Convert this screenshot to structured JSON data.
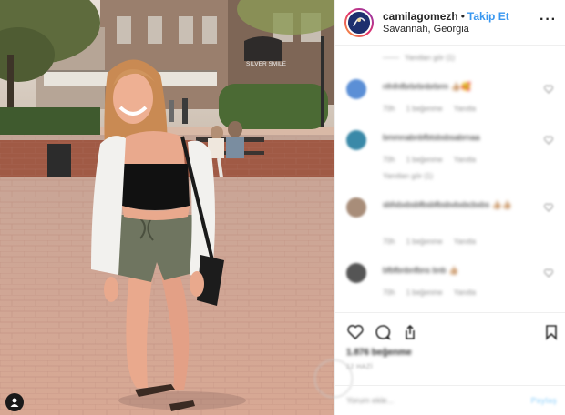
{
  "post": {
    "username": "camilagomezh",
    "separator": "•",
    "follow_label": "Takip Et",
    "location": "Savannah, Georgia",
    "more_icon": "more-horizontal-icon",
    "storefront_sign": "SILVER SMILE"
  },
  "comments": {
    "replies_link": "Yanıtları gör (1)",
    "items": [
      {
        "text": "nfnfnfbrbrbnbrbrm 👍🏼🥰",
        "time": "70h",
        "likes": "1 beğenme",
        "reply": "Yanıtla",
        "sub": "",
        "avatar_color": "#5b8fd6"
      },
      {
        "text": "bmmnabnbfbtsbsbsabrnaa",
        "time": "70h",
        "likes": "1 beğenme",
        "reply": "Yanıtla",
        "sub": "Yanıtları gör (1)",
        "avatar_color": "#3a89a8"
      },
      {
        "text": "sbfxbxbsbfbsbfbsbvbxbcbxbs 👍🏼👍🏼",
        "time": "70h",
        "likes": "1 beğenme",
        "reply": "Yanıtla",
        "sub": "",
        "avatar_color": "#a88d79"
      },
      {
        "text": "bfbfbnbnfbns bnb 👍🏼",
        "time": "70h",
        "likes": "1 beğenme",
        "reply": "Yanıtla",
        "sub": "",
        "avatar_color": "#555555"
      }
    ]
  },
  "actions": {
    "likes_text": "1.876 beğenme",
    "date_text": "12 HAZİ",
    "comment_placeholder": "Yorum ekle...",
    "post_label": "Paylaş"
  },
  "colors": {
    "accent": "#3897f0",
    "text": "#262626",
    "muted": "#8e8e8e",
    "border": "#efefef"
  }
}
